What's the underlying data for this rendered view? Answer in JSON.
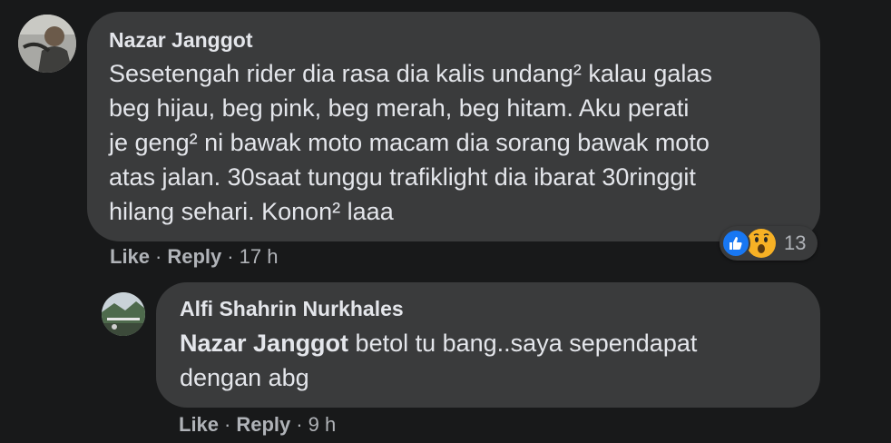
{
  "comments": [
    {
      "author": "Nazar Janggot",
      "text_lines": [
        "Sesetengah rider dia rasa dia kalis undang² kalau galas",
        "beg hijau, beg pink, beg merah, beg hitam. Aku perati",
        "je geng² ni bawak moto macam dia sorang bawak moto",
        "atas jalan. 30saat tunggu trafiklight dia ibarat 30ringgit",
        "hilang sehari. Konon² laaa"
      ],
      "like_label": "Like",
      "reply_label": "Reply",
      "time": "17 h",
      "reactions": {
        "icons": [
          "like-icon",
          "wow-icon"
        ],
        "count": "13"
      }
    },
    {
      "author": "Alfi Shahrin Nurkhales",
      "mention": "Nazar Janggot",
      "text_lines": [
        " betol tu bang..saya sependapat",
        "dengan abg"
      ],
      "like_label": "Like",
      "reply_label": "Reply",
      "time": "9 h"
    }
  ],
  "colors": {
    "background": "#18191a",
    "bubble": "#3a3b3c",
    "text": "#e4e6eb",
    "secondary_text": "#b0b3b8",
    "like_blue": "#1877f2",
    "wow_yellow": "#f7b125"
  }
}
